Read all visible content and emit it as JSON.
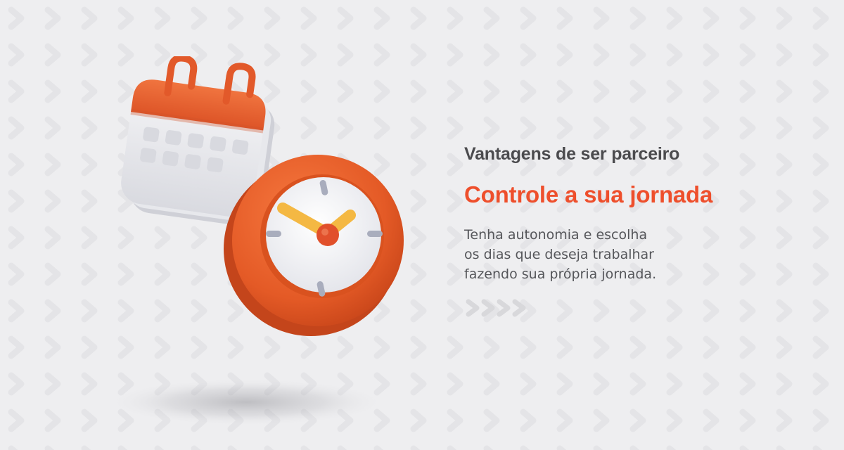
{
  "content": {
    "eyebrow": "Vantagens de ser parceiro",
    "headline": "Controle a sua jornada",
    "body_lines": [
      "Tenha autonomia e escolha",
      "os dias que deseja trabalhar",
      "fazendo sua própria jornada."
    ]
  },
  "illustration": {
    "icons": [
      "calendar-icon",
      "clock-icon"
    ]
  },
  "decor": {
    "chevron_count": 4
  },
  "colors": {
    "background": "#eeeef0",
    "accent": "#ee4f2c",
    "heading": "#4b4b4e",
    "body": "#55565a",
    "chevron": "#d8d8db",
    "clock_hand": "#f4b843"
  }
}
